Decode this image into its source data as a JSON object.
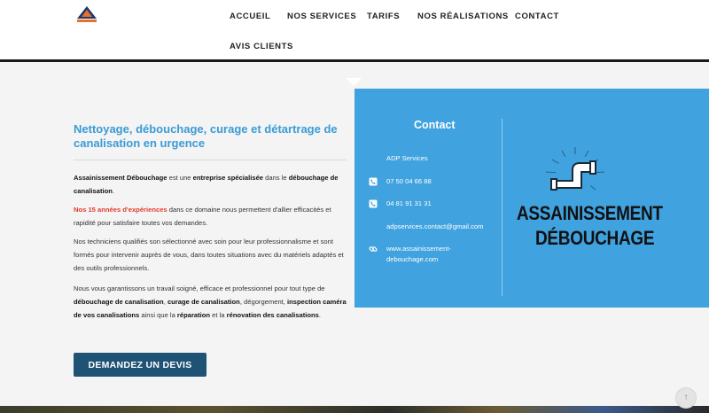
{
  "nav": {
    "items": [
      "ACCUEIL",
      "NOS SERVICES",
      "TARIFS",
      "NOS RÉALISATIONS",
      "CONTACT",
      "AVIS CLIENTS"
    ]
  },
  "main": {
    "headline": "Nettoyage, débouchage, curage et détartrage de canalisation en urgence",
    "p1": {
      "a": "Assainissement Débouchage",
      "b": " est une ",
      "c": "entreprise spécialisée",
      "d": " dans le ",
      "e": "débouchage de canalisation",
      "f": "."
    },
    "p2": {
      "a": "Nos 15 années d'expériences",
      "b": " dans ce domaine nous permettent d'allier efficacités et rapidité pour satisfaire toutes vos demandes."
    },
    "p3": "Nos techniciens qualifiés son sélectionné avec soin pour leur professionnalisme et sont formés pour intervenir auprès de vous, dans toutes situations avec du matériels adaptés et des outils professionnels.",
    "p4": {
      "a": "Nous vous garantissons un travail soigné, efficace et professionnel pour tout type de ",
      "b": "débouchage de canalisation",
      "c": ", ",
      "d": "curage de canalisation",
      "e": ", dégorgement, ",
      "f": "inspection caméra de vos canalisations",
      "g": " ainsi que la ",
      "h": "réparation",
      "i": " et la ",
      "j": "rénovation des canalisations",
      "k": "."
    },
    "cta": "DEMANDEZ UN DEVIS"
  },
  "contact": {
    "title": "Contact",
    "company": "ADP Services",
    "phone1": "07 50 04 66 88",
    "phone2": "04 81 91 31 31",
    "email": "adpservices.contact@gmail.com",
    "website_line1": "www.assainissement-",
    "website_line2": "debouchage.com"
  },
  "brand": {
    "line1": "ASSAINISSEMENT",
    "line2": "DÉBOUCHAGE"
  },
  "colors": {
    "accent": "#40a2de",
    "headline": "#3a9bd6",
    "cta": "#1e5375",
    "highlight": "#e23a2a"
  },
  "icons": {
    "scroll_top": "arrow-up-icon"
  }
}
